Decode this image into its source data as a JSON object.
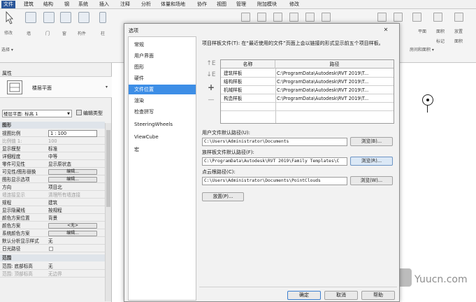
{
  "ribbon": {
    "tabs": [
      "文件",
      "建筑",
      "结构",
      "钢",
      "系统",
      "插入",
      "注释",
      "分析",
      "体量和场地",
      "协作",
      "视图",
      "管理",
      "附加模块",
      "修改"
    ],
    "active_tab": "文件",
    "buttons": [
      "修改",
      "墙",
      "门",
      "窗",
      "构件",
      "柱"
    ],
    "select_label": "选择 ▾",
    "right_buttons": [
      "平面",
      "面积",
      "放置",
      "标记",
      "面积"
    ],
    "right_group": "房间和面积 ▾"
  },
  "properties": {
    "title": "属性",
    "type_name": "楼层平面",
    "filter_value": "楼层平面: 标高 1",
    "edit_type": "编辑类型",
    "header_graphics": "图形",
    "rows": [
      {
        "k": "视图比例",
        "v": "1 : 100",
        "style": "box"
      },
      {
        "k": "比例值 1:",
        "v": "100",
        "style": "grey"
      },
      {
        "k": "显示模型",
        "v": "标准"
      },
      {
        "k": "详细程度",
        "v": "中等"
      },
      {
        "k": "零件可见性",
        "v": "显示原状态"
      },
      {
        "k": "可见性/图形替换",
        "v": "编辑...",
        "style": "btn"
      },
      {
        "k": "图形显示选项",
        "v": "编辑...",
        "style": "btn"
      },
      {
        "k": "方向",
        "v": "项目北"
      },
      {
        "k": "墙连接显示",
        "v": "清理所有墙连接",
        "style": "grey"
      },
      {
        "k": "规程",
        "v": "建筑"
      },
      {
        "k": "显示隐藏线",
        "v": "按规程"
      },
      {
        "k": "颜色方案位置",
        "v": "背景"
      },
      {
        "k": "颜色方案",
        "v": "<无>",
        "style": "btn"
      },
      {
        "k": "系统颜色方案",
        "v": "编辑...",
        "style": "btn"
      },
      {
        "k": "默认分析显示样式",
        "v": "无"
      },
      {
        "k": "日光路径",
        "v": "",
        "style": "check"
      }
    ],
    "header_range": "范围",
    "range_rows": [
      {
        "k": "范围: 底部标高",
        "v": "无"
      },
      {
        "k": "范围: 顶部标高",
        "v": "无边界"
      }
    ]
  },
  "dialog": {
    "title": "选项",
    "close": "✕",
    "nav": [
      "常规",
      "用户界面",
      "图形",
      "硬件",
      "文件位置",
      "渲染",
      "检查拼写",
      "SteeringWheels",
      "ViewCube",
      "宏"
    ],
    "nav_active": "文件位置",
    "templates_label": "项目样板文件(T): 在“最近使用的文件”页面上会以链接的形式显示前五个项目样板。",
    "col_name": "名称",
    "col_path": "路径",
    "templates": [
      {
        "name": "建筑样板",
        "path": "C:\\ProgramData\\Autodesk\\RVT 2019\\T..."
      },
      {
        "name": "结构样板",
        "path": "C:\\ProgramData\\Autodesk\\RVT 2019\\T..."
      },
      {
        "name": "机械样板",
        "path": "C:\\ProgramData\\Autodesk\\RVT 2019\\T..."
      },
      {
        "name": "构造样板",
        "path": "C:\\ProgramData\\Autodesk\\RVT 2019\\T..."
      }
    ],
    "side_buttons": [
      "↑E",
      "↓E",
      "+",
      "—"
    ],
    "user_path_label": "用户文件默认路径(U):",
    "user_path": "C:\\Users\\Administrator\\Documents",
    "family_path_label": "族样板文件默认路径(F):",
    "family_path": "C:\\ProgramData\\Autodesk\\RVT 2019\\Family Templates\\C",
    "cloud_path_label": "点云根路径(C):",
    "cloud_path": "C:\\Users\\Administrator\\Documents\\PointClouds",
    "browse_b": "浏览(B)...",
    "browse_r": "浏览(R)...",
    "browse_w": "浏览(W)...",
    "places": "放置(P)...",
    "ok": "确定",
    "cancel": "取消",
    "help": "帮助"
  },
  "watermark": "Yuucn.com",
  "colors": {
    "accent": "#3d8ee6",
    "file_tab": "#2b579a"
  }
}
